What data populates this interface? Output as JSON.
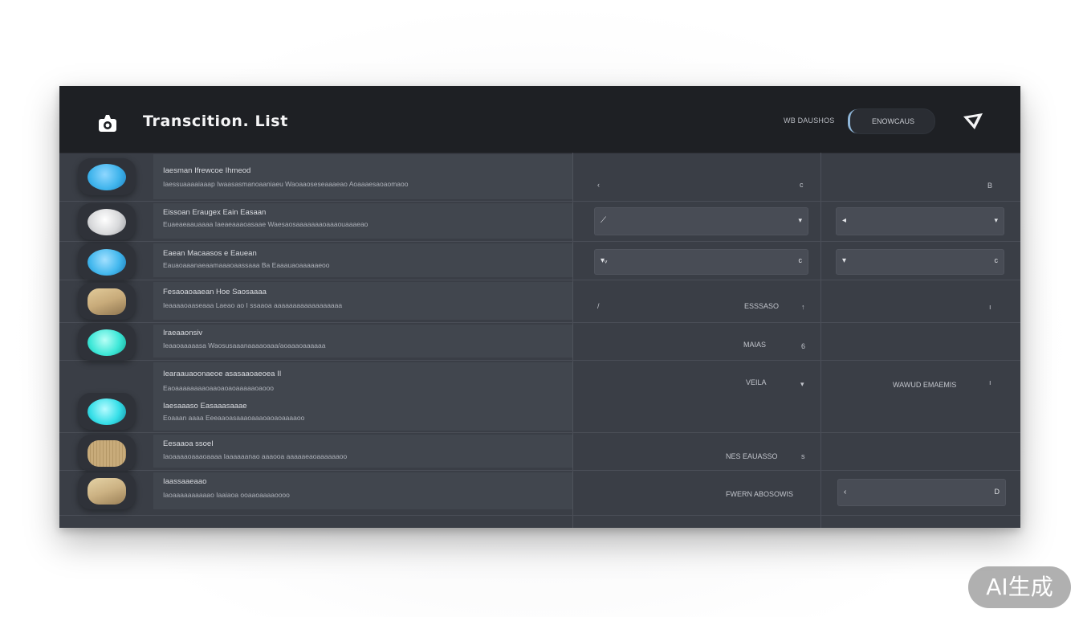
{
  "header": {
    "title": "Transcition. List",
    "link": "WB DAUSHOS",
    "pill": "ENOWCAUS"
  },
  "rows": [
    {
      "title": "Iaesman Ifrewcoe Ihmeod",
      "subtitle": "Iaessuaaaaiaaap Iwaasasmanoaaniaeu Waoaaoseseaaaeao Aoaaaesaoaomaoo",
      "col2_left": "‹",
      "col2_right": "c",
      "col3_right": "B"
    },
    {
      "title": "Eissoan Eraugex Eain Easaan",
      "subtitle": "Euaeaeaauaaaa Iaeaeaaaoasaae Waesaosaaaaaaaoaaaouaaaeao",
      "dropdown1_right": "▾",
      "dropdown2_left": "◂",
      "dropdown2_right": "▾"
    },
    {
      "title": "Eaean Macaasos e Eauean",
      "subtitle": "Eauaoaaanaeaamaaaoaassaaa Ba Eaaauaoaaaaaeoo",
      "dropdown1_left": "▾ᵥ",
      "dropdown1_right": "c",
      "dropdown2_left": "▾",
      "dropdown2_right": "c"
    },
    {
      "title": "Fesaoaoaaean Hoe Saosaaaa",
      "subtitle": "Ieaaaaoaaseaaa Laeao ao I ssaaoa aaaaaaaaaaaaaaaaaa",
      "col2_left": "/",
      "col2_mid": "ESSSASO",
      "col2_right": "↑",
      "col3_right": "ı"
    },
    {
      "title": "Iraeaaonsiv",
      "subtitle": "Ieaaoaaaaasa  Waosusaaanaaaaoaaa/aoaaaoaaaaaa",
      "col2_mid": "MAIAS",
      "col2_right": "6"
    },
    {
      "title": "Iearaauaoonaeoe asasaaoaeoea  II",
      "subtitle": "Eaoaaaaaaaaoaaoaoaoaaaaaoaooo",
      "title2": "Iaesaaaso Easaaasaaae",
      "subtitle2": "Eoaaan aaaa Eeeaaoasaaaoaaaoaoaoaaaaoo",
      "col2_mid": "VEILA",
      "col2_right": "▾",
      "col3_mid": "WAWUD EMAEMIS",
      "col3_right": "ı"
    },
    {
      "title": "Eesaaoa  ssoeI",
      "subtitle": "Iaoaaaaoaaaoaaaa  Iaaaaaanao aaaooa aaaaaeaoaaaaaaoo",
      "col2_mid": "NES EAUASSO",
      "col2_right": "s"
    },
    {
      "title": "Iaassaaeaao",
      "subtitle": "Iaoaaaaaaaaaao Iaaiaoa ooaaoaaaaoooo",
      "col2_mid": "FWERN ABOSOWIS",
      "dropdown2_left": "‹",
      "dropdown2_right": "D"
    }
  ],
  "colors": {
    "header_bg": "#1e2024",
    "body_bg": "#3a3e46",
    "gem_blue": "#3fb4ec",
    "gem_teal": "#3ee8d8",
    "gem_gold": "#c8ab7a",
    "gem_silver": "#d8d9db"
  },
  "icons": [
    "camera-icon",
    "dropdown-chevron-icon",
    "brand-logo-icon"
  ],
  "watermark": "AI生成"
}
